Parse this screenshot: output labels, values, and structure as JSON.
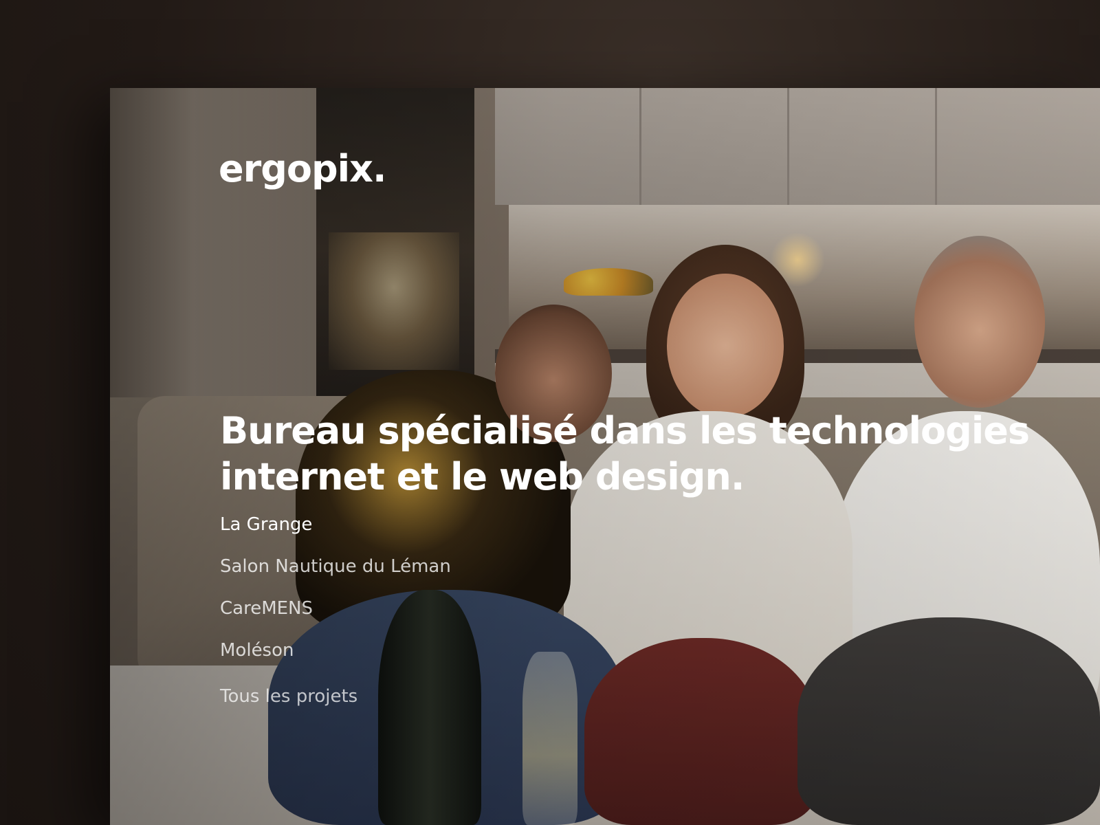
{
  "brand": {
    "logo": "ergopix."
  },
  "hero": {
    "headline": "Bureau spécialisé dans les technologies internet et le web design."
  },
  "projects": {
    "items": [
      {
        "label": "La Grange",
        "active": true
      },
      {
        "label": "Salon Nautique du Léman",
        "active": false
      },
      {
        "label": "CareMENS",
        "active": false
      },
      {
        "label": "Moléson",
        "active": false
      }
    ],
    "all_label": "Tous les projets"
  },
  "colors": {
    "background": "#221a16",
    "text": "#ffffff"
  }
}
